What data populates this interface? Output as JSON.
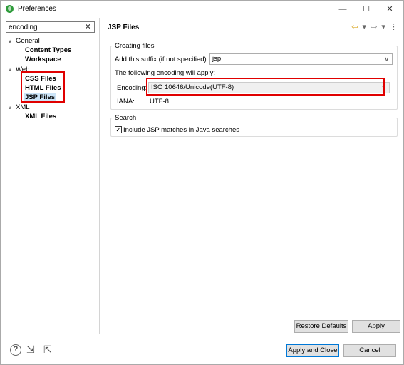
{
  "window": {
    "title": "Preferences",
    "minimize": "—",
    "maximize": "☐",
    "close": "✕"
  },
  "filter": {
    "value": "encoding",
    "clear": "✕"
  },
  "tree": {
    "general": {
      "twisty": "∨",
      "label": "General"
    },
    "content_types": "Content Types",
    "workspace": "Workspace",
    "web": {
      "twisty": "∨",
      "label": "Web"
    },
    "css_files": "CSS Files",
    "html_files": "HTML Files",
    "jsp_files": "JSP Files",
    "xml": {
      "twisty": "∨",
      "label": "XML"
    },
    "xml_files": "XML Files"
  },
  "page": {
    "title": "JSP Files",
    "nav": {
      "back": "⇦",
      "back_menu": "▾",
      "forward": "⇨",
      "forward_menu": "▾",
      "more": "⋮"
    }
  },
  "creating_files": {
    "group_title": "Creating files",
    "suffix_label": "Add this suffix (if not specified):",
    "suffix_value": "jsp",
    "encoding_note": "The following encoding will apply:",
    "encoding_label": "Encoding:",
    "encoding_value": "ISO 10646/Unicode(UTF-8)",
    "iana_label": "IANA:",
    "iana_value": "UTF-8"
  },
  "search": {
    "group_title": "Search",
    "include_label": "Include JSP matches in Java searches",
    "include_checked": "✓"
  },
  "buttons": {
    "restore_defaults": "Restore Defaults",
    "apply": "Apply",
    "apply_and_close": "Apply and Close",
    "cancel": "Cancel"
  },
  "footer_icons": {
    "help": "?",
    "import": "⇲",
    "export": "⇱"
  },
  "colors": {
    "highlight": "#e00000",
    "selection": "#cce4f7",
    "default_button_border": "#0078d7"
  }
}
